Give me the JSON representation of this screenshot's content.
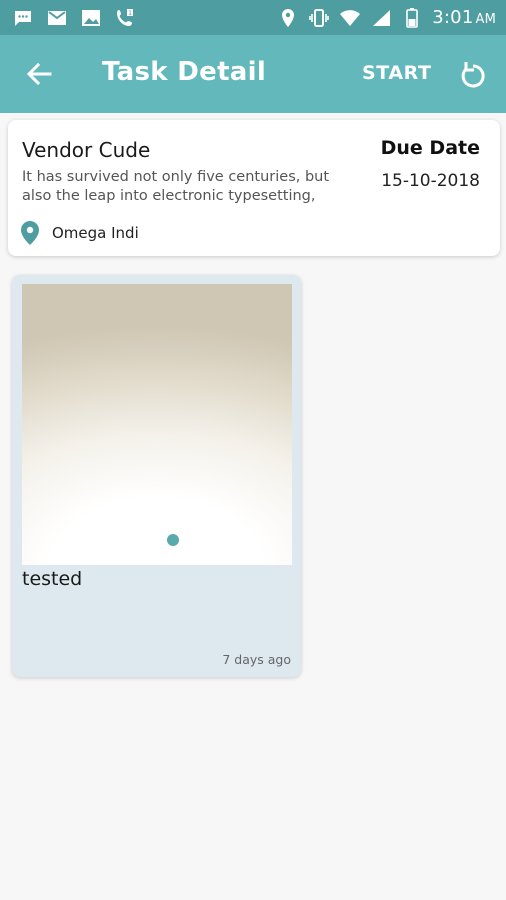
{
  "status_bar": {
    "time": "3:01",
    "ampm": "AM",
    "left_icons": [
      "chat-icon",
      "gmail-icon",
      "gallery-icon",
      "missed-call-icon"
    ],
    "right_icons": [
      "location-icon",
      "vibrate-icon",
      "wifi-icon",
      "signal-icon",
      "battery-icon"
    ]
  },
  "app_bar": {
    "title": "Task Detail",
    "action_label": "START",
    "background": "#63b8bb"
  },
  "task": {
    "vendor": "Vendor Cude",
    "description": "It has survived not only five centuries, but also the leap into electronic typesetting,",
    "due_label": "Due Date",
    "due_date": "15-10-2018",
    "location": "Omega Indi",
    "accent": "#4e9ea1"
  },
  "media": [
    {
      "title": "tested",
      "time": "7 days ago"
    }
  ]
}
